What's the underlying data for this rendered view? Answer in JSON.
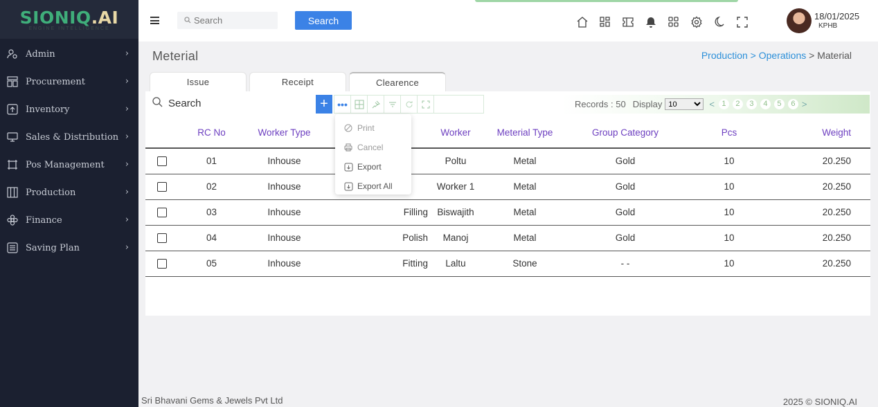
{
  "brand": {
    "logo_main": "SIONIQ",
    "logo_ai": ".AI",
    "logo_sub": "ENGINE INTELLIGENCE"
  },
  "sidebar": {
    "items": [
      {
        "label": "Admin",
        "icon": "users-icon"
      },
      {
        "label": "Procurement",
        "icon": "grid-icon"
      },
      {
        "label": "Inventory",
        "icon": "upload-box-icon"
      },
      {
        "label": "Sales & Distribution",
        "icon": "monitor-icon"
      },
      {
        "label": "Pos Management",
        "icon": "frame-icon"
      },
      {
        "label": "Production",
        "icon": "columns-icon"
      },
      {
        "label": "Finance",
        "icon": "flower-icon"
      },
      {
        "label": "Saving Plan",
        "icon": "list-box-icon"
      }
    ]
  },
  "header": {
    "search_placeholder": "Search",
    "search_button": "Search",
    "date": "18/01/2025",
    "location": "KPHB"
  },
  "page": {
    "title": "Meterial",
    "breadcrumb": {
      "part1": "Production",
      "sep": " > ",
      "part2": "Operations",
      "part3": "Material"
    }
  },
  "tabs": [
    "Issue",
    "Receipt",
    "Clearence"
  ],
  "toolbar": {
    "search_placeholder": "Search",
    "plus": "+",
    "more": "•••",
    "records_label": "Records : 50",
    "display_label": "Display",
    "display_value": "10",
    "pages": [
      "1",
      "2",
      "3",
      "4",
      "5",
      "6"
    ],
    "prev": "<",
    "next": ">"
  },
  "dropdown": {
    "items": [
      "Print",
      "Cancel",
      "Export",
      "Export All"
    ]
  },
  "table": {
    "headers": [
      "",
      "RC No",
      "Worker Type",
      "",
      "Worker",
      "Meterial Type",
      "Group Category",
      "Pcs",
      "Weight"
    ],
    "rows": [
      [
        "01",
        "Inhouse",
        "",
        "Poltu",
        "Metal",
        "Gold",
        "10",
        "20.250"
      ],
      [
        "02",
        "Inhouse",
        "",
        "Worker 1",
        "Metal",
        "Gold",
        "10",
        "20.250"
      ],
      [
        "03",
        "Inhouse",
        "Filling",
        "Biswajith",
        "Metal",
        "Gold",
        "10",
        "20.250"
      ],
      [
        "04",
        "Inhouse",
        "Polish",
        "Manoj",
        "Metal",
        "Gold",
        "10",
        "20.250"
      ],
      [
        "05",
        "Inhouse",
        "Fitting",
        "Laltu",
        "Stone",
        "- -",
        "10",
        "20.250"
      ]
    ]
  },
  "footer": {
    "company": "Sri Bhavani Gems & Jewels Pvt Ltd",
    "copyright": "2025 © SIONIQ.AI"
  },
  "colors": {
    "sidebar_bg": "#1b2030",
    "accent": "#3b82e6",
    "header_text": "#6d3fc0",
    "breadcrumb_link": "#2b8fd9",
    "logo_green": "#3fae7a"
  }
}
